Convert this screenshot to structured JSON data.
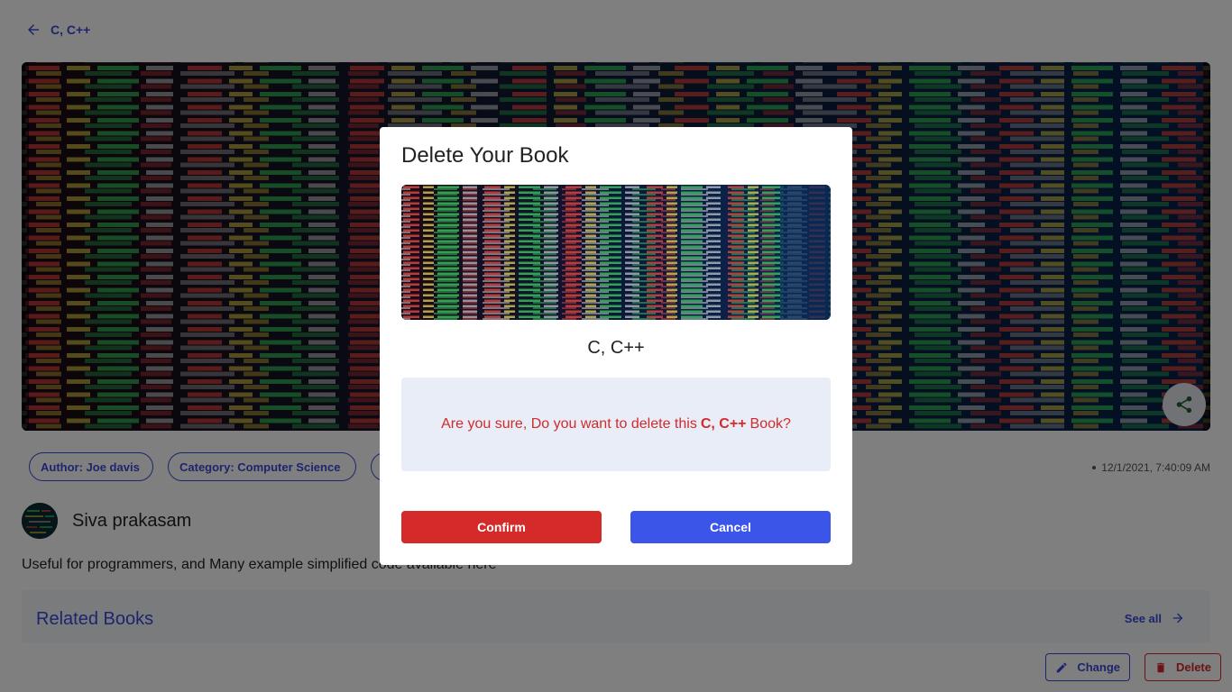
{
  "header": {
    "back_label": "C, C++"
  },
  "book": {
    "title": "C, C++",
    "author_chip": "Author: Joe davis",
    "category_chip": "Category: Computer Science",
    "timestamp": "12/1/2021, 7:40:09 AM",
    "owner_name": "Siva prakasam",
    "description": "Useful for programmers, and Many example simplified code available here"
  },
  "related": {
    "title": "Related Books",
    "see_all_label": "See all"
  },
  "actions": {
    "change_label": "Change",
    "delete_label": "Delete"
  },
  "modal": {
    "title": "Delete Your Book",
    "book_title": "C, C++",
    "message_prefix": "Are you sure, Do you want to delete this",
    "message_book": "C, C++",
    "message_suffix": "Book?",
    "confirm_label": "Confirm",
    "cancel_label": "Cancel"
  },
  "colors": {
    "accent": "#3a4bd8",
    "danger": "#d42a2a",
    "cancel": "#3a55e8",
    "overlay": "rgba(0,0,0,0.5)"
  },
  "icons": {
    "back": "arrow-left-icon",
    "share": "share-icon",
    "see_all": "arrow-right-icon",
    "change": "pencil-icon",
    "delete": "trash-icon"
  }
}
